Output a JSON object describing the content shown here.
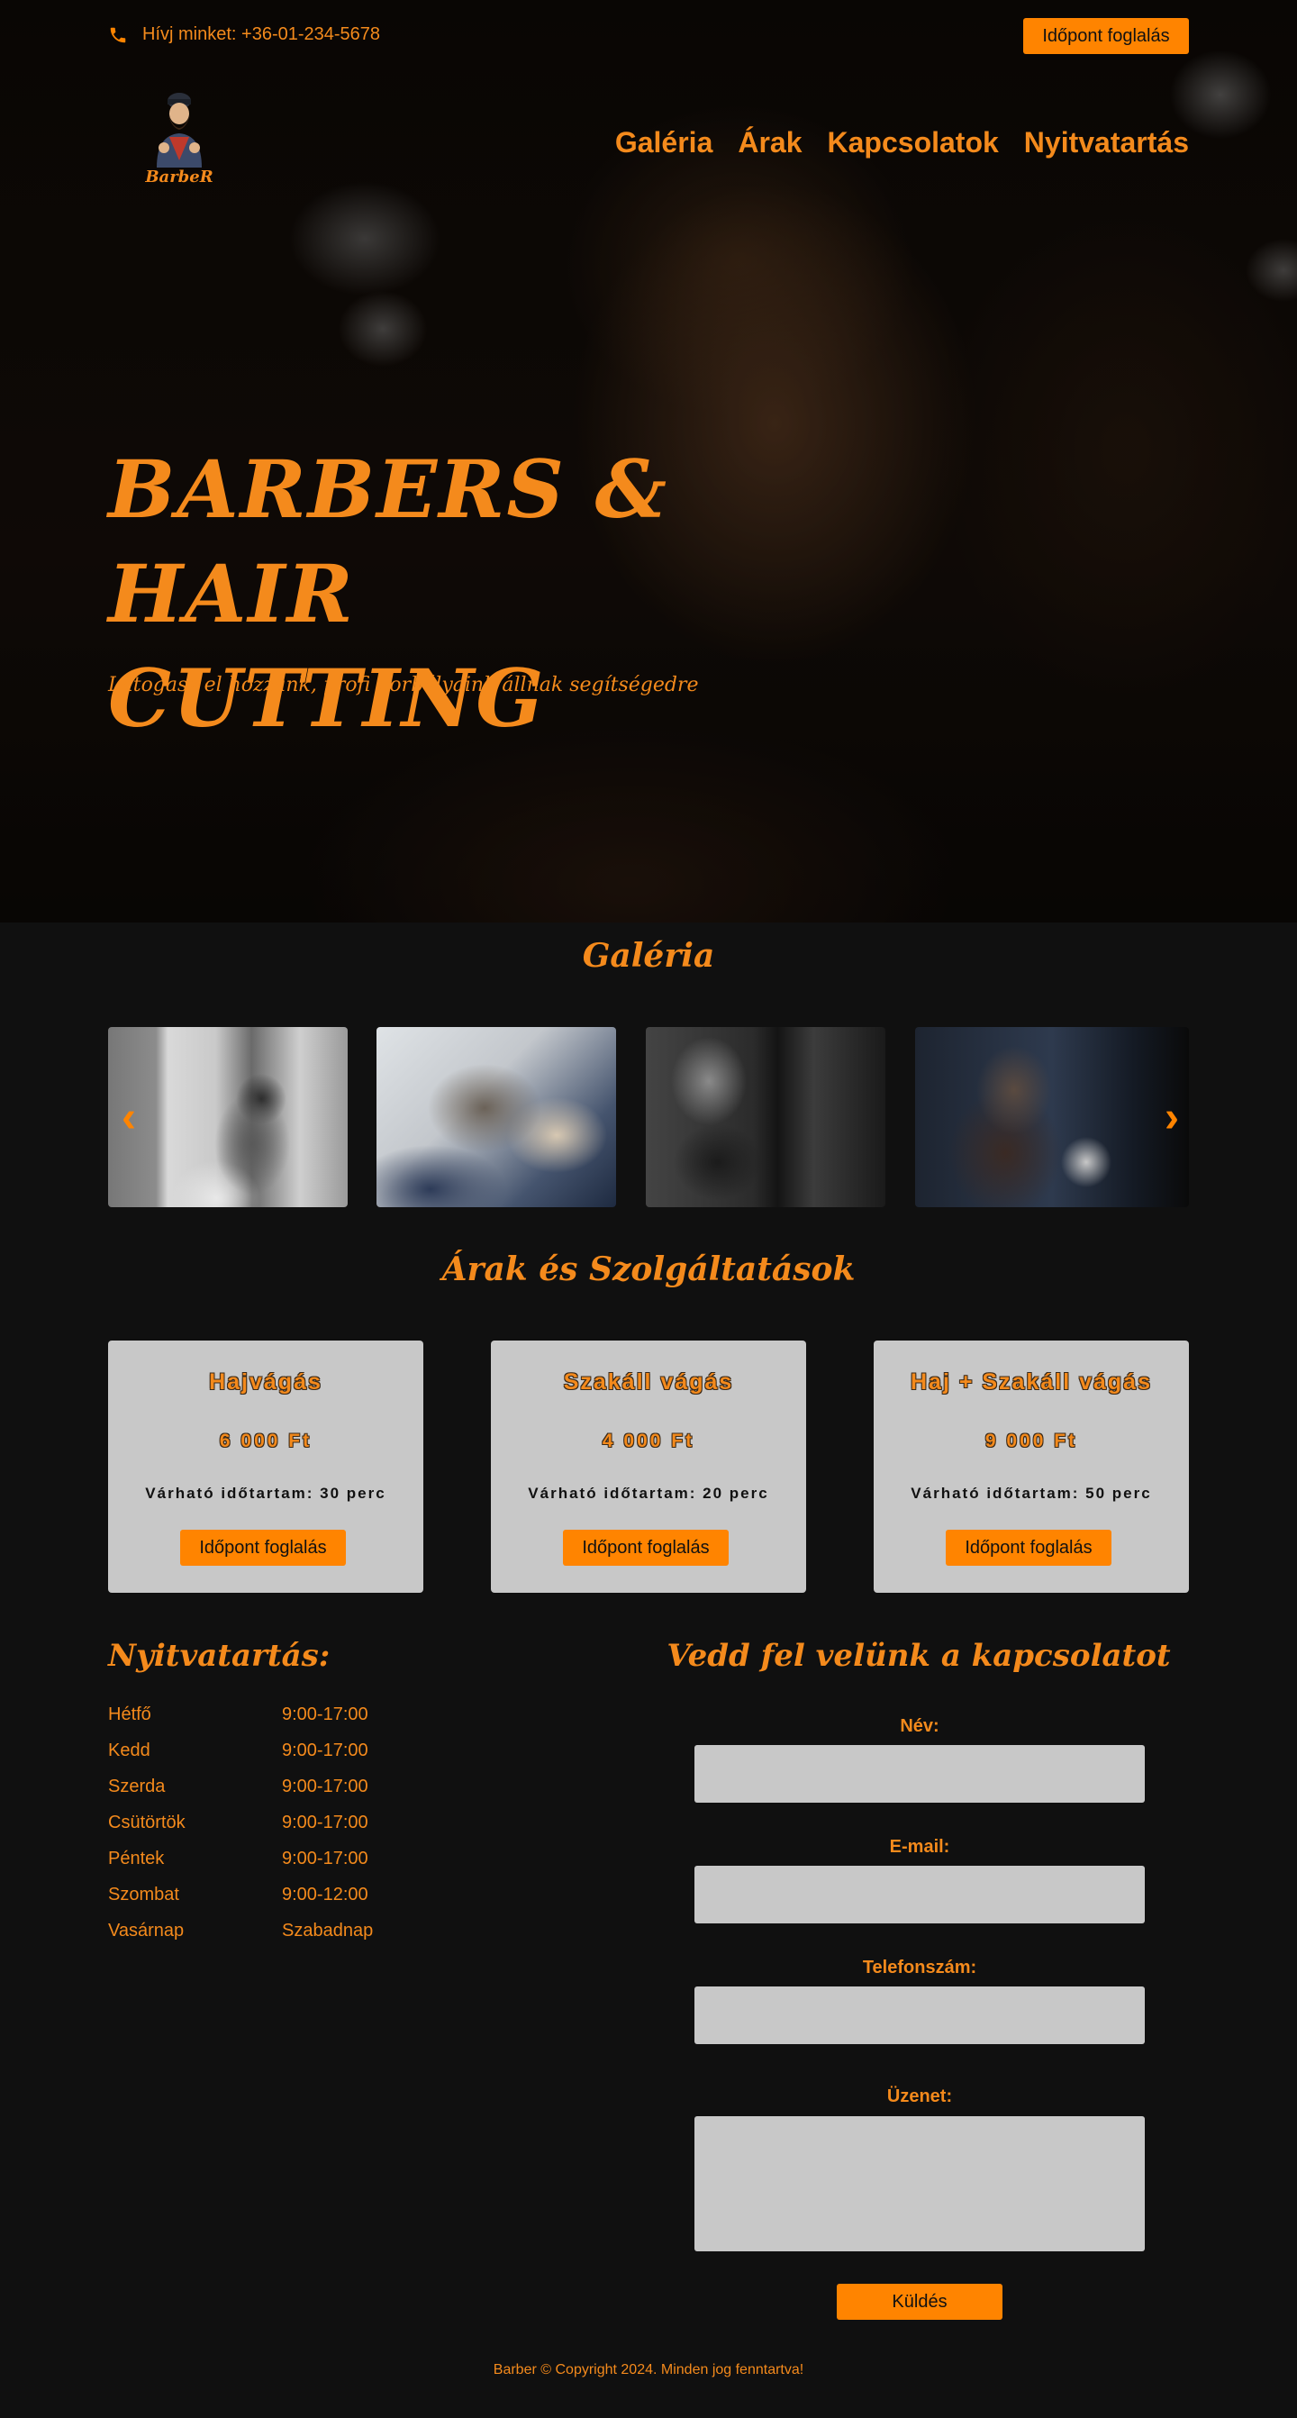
{
  "topbar": {
    "phone_icon": "phone-icon",
    "phone_text": "Hívj minket: +36-01-234-5678",
    "book_button": "Időpont foglalás"
  },
  "logo": {
    "text": "BarbeR"
  },
  "nav": {
    "items": [
      {
        "label": "Galéria"
      },
      {
        "label": "Árak"
      },
      {
        "label": "Kapcsolatok"
      },
      {
        "label": "Nyitvatartás"
      }
    ]
  },
  "hero": {
    "title_line1": "BARBERS &",
    "title_line2": "HAIR CUTTING",
    "subtitle": "Látogass el hozzánk, profi borbélyaink állnak segítségedre"
  },
  "gallery": {
    "title": "Galéria",
    "prev_icon": "‹",
    "next_icon": "›"
  },
  "prices": {
    "title": "Árak és Szolgáltatások",
    "cards": [
      {
        "name": "Hajvágás",
        "price": "6 000 Ft",
        "duration": "Várható időtartam: 30 perc",
        "button": "Időpont foglalás"
      },
      {
        "name": "Szakáll vágás",
        "price": "4 000 Ft",
        "duration": "Várható időtartam: 20 perc",
        "button": "Időpont foglalás"
      },
      {
        "name": "Haj + Szakáll vágás",
        "price": "9 000 Ft",
        "duration": "Várható időtartam: 50 perc",
        "button": "Időpont foglalás"
      }
    ]
  },
  "hours": {
    "title": "Nyitvatartás:",
    "rows": [
      {
        "day": "Hétfő",
        "time": "9:00-17:00"
      },
      {
        "day": "Kedd",
        "time": "9:00-17:00"
      },
      {
        "day": "Szerda",
        "time": "9:00-17:00"
      },
      {
        "day": "Csütörtök",
        "time": "9:00-17:00"
      },
      {
        "day": "Péntek",
        "time": "9:00-17:00"
      },
      {
        "day": "Szombat",
        "time": "9:00-12:00"
      },
      {
        "day": "Vasárnap",
        "time": "Szabadnap"
      }
    ]
  },
  "contact": {
    "title": "Vedd fel velünk a kapcsolatot",
    "name_label": "Név:",
    "name_value": "",
    "email_label": "E-mail:",
    "email_value": "",
    "phone_label": "Telefonszám:",
    "phone_value": "",
    "message_label": "Üzenet:",
    "message_value": "",
    "send_button": "Küldés"
  },
  "footer": {
    "text": "Barber © Copyright 2024. Minden jog fenntartva!"
  },
  "colors": {
    "accent": "#f48a1c",
    "button": "#ff8400",
    "background": "#101010",
    "card": "#c8c8c8"
  }
}
